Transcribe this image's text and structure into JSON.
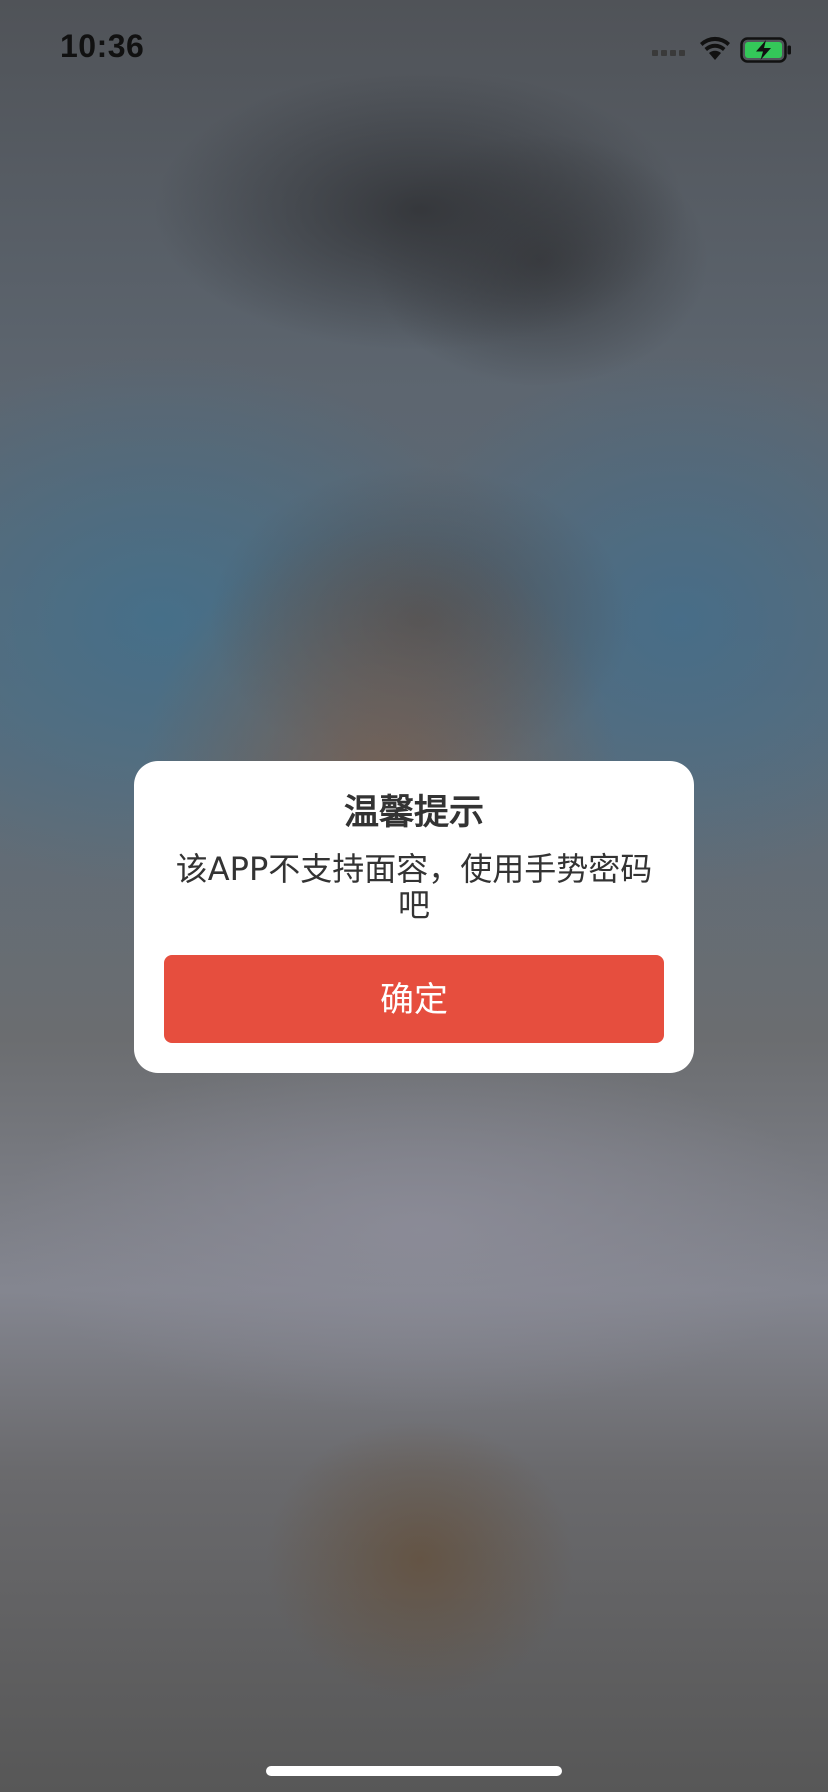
{
  "status_bar": {
    "time": "10:36",
    "signal_icon": "cellular-signal-icon",
    "wifi_icon": "wifi-icon",
    "battery_icon": "battery-charging-icon",
    "battery_color": "#34c759"
  },
  "dialog": {
    "title": "温馨提示",
    "message": "该APP不支持面容，使用手势密码吧",
    "confirm_label": "确定",
    "button_color": "#e64e3e"
  },
  "home_indicator_icon": "home-indicator"
}
